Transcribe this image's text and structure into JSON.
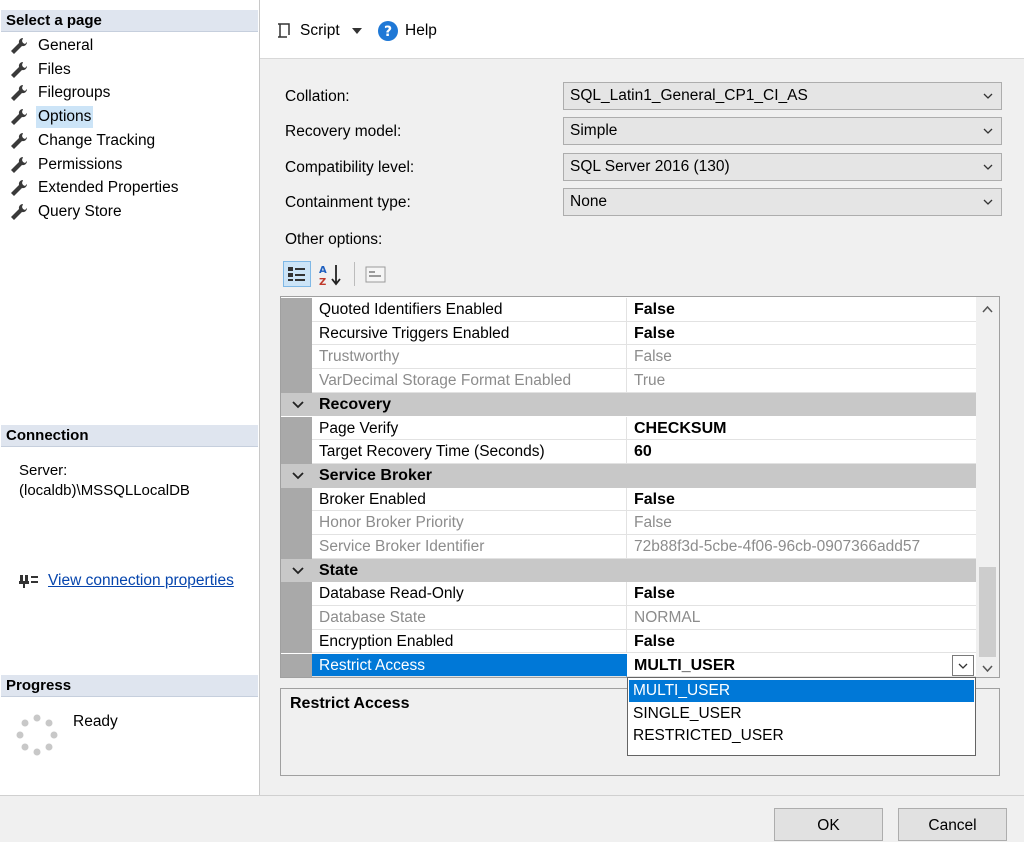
{
  "left": {
    "select_page_header": "Select a page",
    "pages": [
      "General",
      "Files",
      "Filegroups",
      "Options",
      "Change Tracking",
      "Permissions",
      "Extended Properties",
      "Query Store"
    ],
    "selected_page": "Options",
    "connection_header": "Connection",
    "server_label": "Server:",
    "server_value": "(localdb)\\MSSQLLocalDB",
    "view_connection_link": "View connection properties",
    "progress_header": "Progress",
    "progress_status": "Ready"
  },
  "toolbar": {
    "script_label": "Script",
    "help_label": "Help"
  },
  "form": {
    "collation_label": "Collation:",
    "collation_value": "SQL_Latin1_General_CP1_CI_AS",
    "recovery_label": "Recovery model:",
    "recovery_value": "Simple",
    "compat_label": "Compatibility level:",
    "compat_value": "SQL Server 2016 (130)",
    "containment_label": "Containment type:",
    "containment_value": "None",
    "other_options_label": "Other options:"
  },
  "grid": {
    "rows": [
      {
        "name": "Quoted Identifiers Enabled",
        "value": "False"
      },
      {
        "name": "Recursive Triggers Enabled",
        "value": "False"
      },
      {
        "name": "Trustworthy",
        "value": "False"
      },
      {
        "name": "VarDecimal Storage Format Enabled",
        "value": "True"
      },
      {
        "category": "Recovery"
      },
      {
        "name": "Page Verify",
        "value": "CHECKSUM"
      },
      {
        "name": "Target Recovery Time (Seconds)",
        "value": "60"
      },
      {
        "category": "Service Broker"
      },
      {
        "name": "Broker Enabled",
        "value": "False"
      },
      {
        "name": "Honor Broker Priority",
        "value": "False"
      },
      {
        "name": "Service Broker Identifier",
        "value": "72b88f3d-5cbe-4f06-96cb-0907366add57"
      },
      {
        "category": "State"
      },
      {
        "name": "Database Read-Only",
        "value": "False"
      },
      {
        "name": "Database State",
        "value": "NORMAL"
      },
      {
        "name": "Encryption Enabled",
        "value": "False"
      },
      {
        "name": "Restrict Access",
        "value": "MULTI_USER"
      }
    ]
  },
  "dropdown": {
    "options": [
      "MULTI_USER",
      "SINGLE_USER",
      "RESTRICTED_USER"
    ],
    "highlighted": "MULTI_USER"
  },
  "description": {
    "title": "Restrict Access"
  },
  "buttons": {
    "ok": "OK",
    "cancel": "Cancel"
  }
}
